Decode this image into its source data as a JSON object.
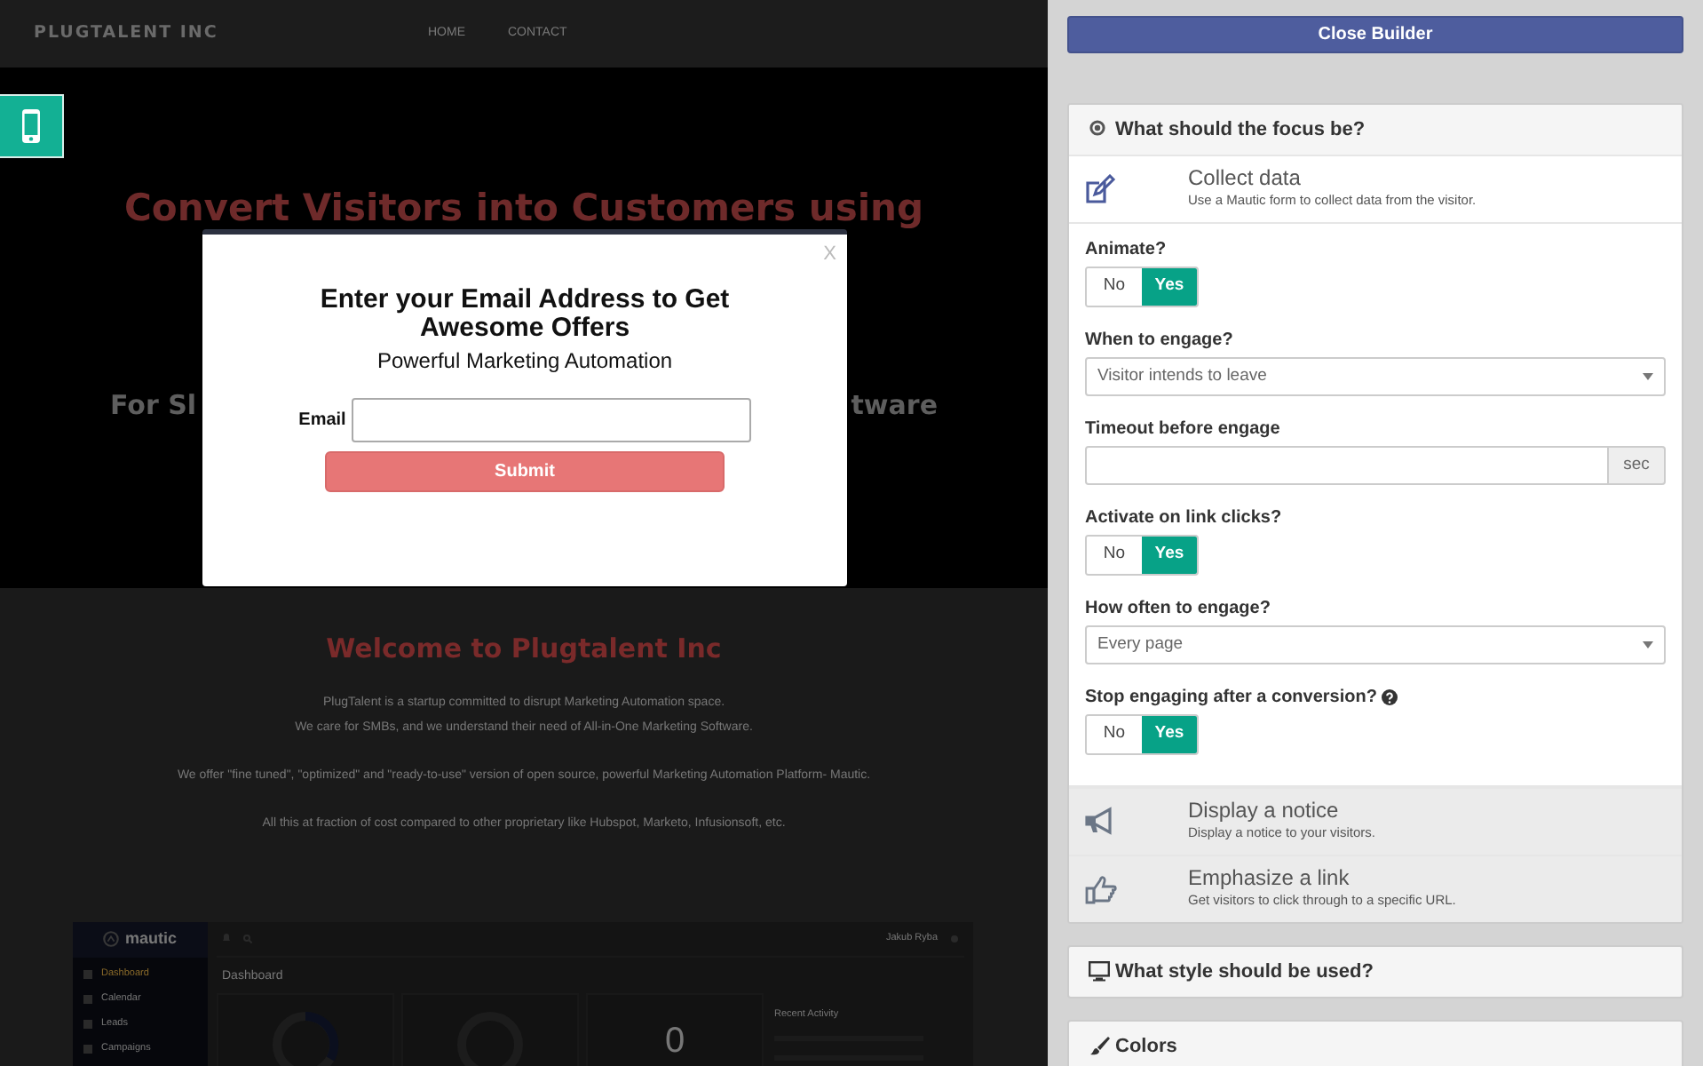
{
  "site": {
    "brand": "PLUGTALENT INC",
    "nav": [
      "HOME",
      "CONTACT"
    ],
    "hero_title": "Convert Visitors into Customers using",
    "hero_subtitle_fragments": [
      "For Sl",
      "tware"
    ],
    "welcome_title": "Welcome to Plugtalent Inc",
    "paragraphs": [
      [
        "PlugTalent is a startup committed to disrupt Marketing Automation space.",
        "We care for SMBs, and we understand their need of All-in-One Marketing Software."
      ],
      [
        "We offer \"fine tuned\", \"optimized\" and \"ready-to-use\" version of open source, powerful Marketing Automation Platform- Mautic."
      ],
      [
        "All this at fraction of cost compared to other proprietary like Hubspot, Marketo, Infusionsoft, etc."
      ]
    ],
    "dashboard_preview": {
      "logo": "mautic",
      "menu": [
        "Dashboard",
        "Calendar",
        "Leads",
        "Campaigns"
      ],
      "user": "Jakub Ryba",
      "heading": "Dashboard",
      "activity_title": "Recent Activity",
      "counter": "0"
    }
  },
  "popup": {
    "close": "X",
    "title": "Enter your Email Address to Get Awesome Offers",
    "subtitle": "Powerful Marketing Automation",
    "field_label": "Email",
    "submit": "Submit"
  },
  "builder": {
    "close_button": "Close Builder",
    "sections": [
      {
        "kind": "focus",
        "title": "What should the focus be?",
        "expanded": true,
        "options": [
          {
            "kind": "form",
            "title": "Collect data",
            "description": "Use a Mautic form to collect data from the visitor.",
            "selected": true
          },
          {
            "kind": "notice",
            "title": "Display a notice",
            "description": "Display a notice to your visitors.",
            "selected": false
          },
          {
            "kind": "link",
            "title": "Emphasize a link",
            "description": "Get visitors to click through to a specific URL.",
            "selected": false
          }
        ],
        "fields": [
          {
            "kind": "toggle",
            "label": "Animate?",
            "no": "No",
            "yes": "Yes",
            "on": true
          },
          {
            "kind": "select",
            "label": "When to engage?",
            "value": "Visitor intends to leave"
          },
          {
            "kind": "addon",
            "label": "Timeout before engage",
            "addon": "sec"
          },
          {
            "kind": "toggle",
            "label": "Activate on link clicks?",
            "no": "No",
            "yes": "Yes",
            "on": true
          },
          {
            "kind": "select",
            "label": "How often to engage?",
            "value": "Every page"
          },
          {
            "kind": "toggle",
            "label": "Stop engaging after a conversion?",
            "help": true,
            "no": "No",
            "yes": "Yes",
            "on": true
          }
        ]
      },
      {
        "kind": "style",
        "title": "What style should be used?",
        "expanded": false
      },
      {
        "kind": "colors",
        "title": "Colors",
        "expanded": false
      }
    ]
  }
}
